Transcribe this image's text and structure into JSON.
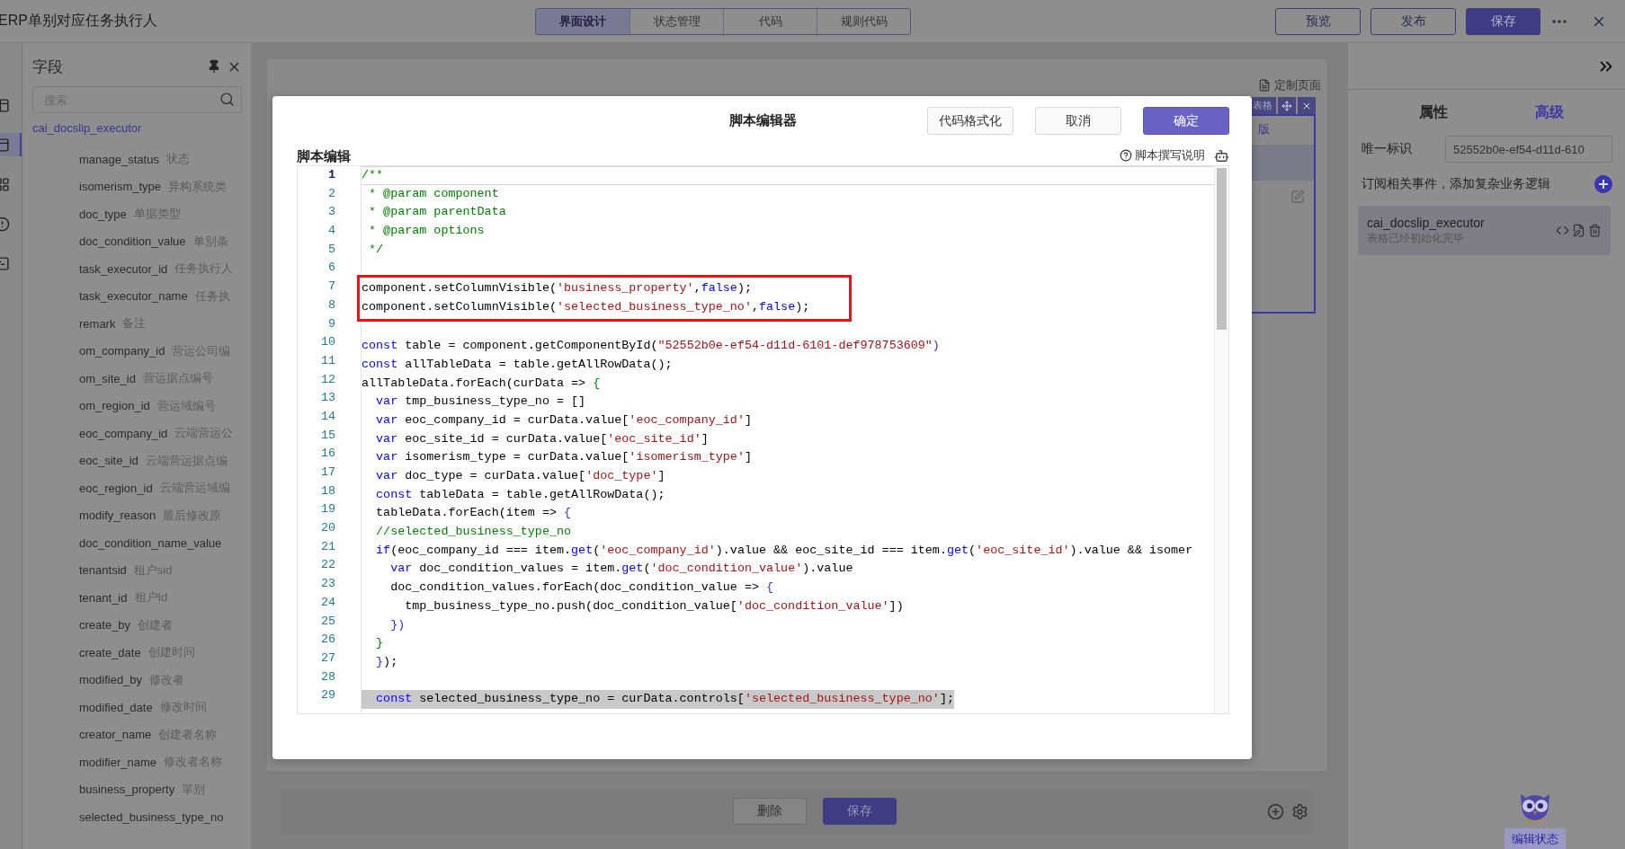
{
  "topbar": {
    "title": "ERP单别对应任务执行人",
    "tabs": [
      {
        "label": "界面设计",
        "selected": true
      },
      {
        "label": "状态管理",
        "selected": false
      },
      {
        "label": "代码",
        "selected": false
      },
      {
        "label": "规则代码",
        "selected": false
      }
    ],
    "buttons": [
      {
        "label": "预览",
        "kind": "outline"
      },
      {
        "label": "发布",
        "kind": "outline"
      },
      {
        "label": "保存",
        "kind": "primary"
      }
    ]
  },
  "sidebar_icons": [
    {
      "kind": "table",
      "selected": false
    },
    {
      "kind": "form",
      "selected": true
    },
    {
      "kind": "grid",
      "selected": false
    },
    {
      "kind": "alert",
      "selected": false
    },
    {
      "kind": "terminal",
      "selected": false
    }
  ],
  "field_panel": {
    "title": "字段",
    "search": {
      "placeholder": "搜索"
    },
    "table_name": "cai_docslip_executor",
    "fields": [
      {
        "name": "manage_status",
        "label": "状态"
      },
      {
        "name": "isomerism_type",
        "label": "异构系统类"
      },
      {
        "name": "doc_type",
        "label": "单据类型"
      },
      {
        "name": "doc_condition_value",
        "label": "单别条"
      },
      {
        "name": "task_executor_id",
        "label": "任务执行人"
      },
      {
        "name": "task_executor_name",
        "label": "任务执"
      },
      {
        "name": "remark",
        "label": "备注"
      },
      {
        "name": "om_company_id",
        "label": "营运公司编"
      },
      {
        "name": "om_site_id",
        "label": "营运据点编号"
      },
      {
        "name": "om_region_id",
        "label": "营运域编号"
      },
      {
        "name": "eoc_company_id",
        "label": "云端营运公"
      },
      {
        "name": "eoc_site_id",
        "label": "云端营运据点编"
      },
      {
        "name": "eoc_region_id",
        "label": "云端营运域编"
      },
      {
        "name": "modify_reason",
        "label": "最后修改原"
      },
      {
        "name": "doc_condition_name_value"
      },
      {
        "name": "tenantsid",
        "label": "租户sid"
      },
      {
        "name": "tenant_id",
        "label": "租户Id"
      },
      {
        "name": "create_by",
        "label": "创建者"
      },
      {
        "name": "create_date",
        "label": "创建时间"
      },
      {
        "name": "modified_by",
        "label": "修改者"
      },
      {
        "name": "modified_date",
        "label": "修改时间"
      },
      {
        "name": "creator_name",
        "label": "创建者名称"
      },
      {
        "name": "modifier_name",
        "label": "修改者名称"
      },
      {
        "name": "business_property",
        "label": "單别"
      },
      {
        "name": "selected_business_type_no"
      }
    ]
  },
  "canvas": {
    "page_label": "定制页面",
    "widget": {
      "tag": "表格",
      "link": "版"
    },
    "footer_buttons": [
      {
        "label": "删除",
        "kind": "default"
      },
      {
        "label": "保存",
        "kind": "primary"
      }
    ]
  },
  "properties": {
    "tabs": [
      {
        "label": "属性",
        "selected": false
      },
      {
        "label": "高级",
        "selected": true
      }
    ],
    "id_label": "唯一标识",
    "id_value": "52552b0e-ef54-d11d-610",
    "events_label": "订阅相关事件，添加复杂业务逻辑",
    "events": [
      {
        "name": "cai_docslip_executor",
        "description": "表格已经初始化完毕"
      }
    ]
  },
  "assistant": {
    "label": "编辑状态"
  },
  "dialog": {
    "title": "脚本编辑器",
    "buttons": [
      {
        "label": "代码格式化",
        "kind": "default"
      },
      {
        "label": "取消",
        "kind": "default"
      },
      {
        "label": "确定",
        "kind": "primary"
      }
    ],
    "section_label": "脚本编辑",
    "help_link": "脚本撰写说明",
    "lines": [
      {
        "n": "1",
        "current": true,
        "boxed": false,
        "selected": false,
        "tokens": [
          {
            "kind": "comment",
            "text": "/**"
          }
        ]
      },
      {
        "n": "2",
        "current": false,
        "boxed": false,
        "selected": false,
        "tokens": [
          {
            "kind": "comment",
            "text": " * @param component"
          }
        ]
      },
      {
        "n": "3",
        "current": false,
        "boxed": false,
        "selected": false,
        "tokens": [
          {
            "kind": "comment",
            "text": " * @param parentData"
          }
        ]
      },
      {
        "n": "4",
        "current": false,
        "boxed": false,
        "selected": false,
        "tokens": [
          {
            "kind": "comment",
            "text": " * @param options"
          }
        ]
      },
      {
        "n": "5",
        "current": false,
        "boxed": false,
        "selected": false,
        "tokens": [
          {
            "kind": "comment",
            "text": " */"
          }
        ]
      },
      {
        "n": "6",
        "current": false,
        "boxed": false,
        "selected": false
      },
      {
        "n": "7",
        "current": false,
        "boxed": true,
        "selected": false,
        "tokens": [
          {
            "kind": "plain",
            "text": "component.setColumnVisible("
          },
          {
            "kind": "string",
            "text": "'business_property'"
          },
          {
            "kind": "plain",
            "text": ","
          },
          {
            "kind": "keyword",
            "text": "false"
          },
          {
            "kind": "plain",
            "text": ");"
          }
        ]
      },
      {
        "n": "8",
        "current": false,
        "boxed": true,
        "selected": false,
        "tokens": [
          {
            "kind": "plain",
            "text": "component.setColumnVisible("
          },
          {
            "kind": "string",
            "text": "'selected_business_type_no'"
          },
          {
            "kind": "plain",
            "text": ","
          },
          {
            "kind": "keyword",
            "text": "false"
          },
          {
            "kind": "plain",
            "text": ");"
          }
        ]
      },
      {
        "n": "9",
        "current": false,
        "boxed": false,
        "selected": false
      },
      {
        "n": "10",
        "current": false,
        "boxed": false,
        "selected": false,
        "tokens": [
          {
            "kind": "keyword",
            "text": "const"
          },
          {
            "kind": "plain",
            "text": " table = component.getComponentById("
          },
          {
            "kind": "string",
            "text": "\"52552b0e-ef54-d11d-6101-def978753609\""
          },
          {
            "kind": "bracket",
            "text": ")"
          }
        ]
      },
      {
        "n": "11",
        "current": false,
        "boxed": false,
        "selected": false,
        "tokens": [
          {
            "kind": "keyword",
            "text": "const"
          },
          {
            "kind": "plain",
            "text": " allTableData = table.getAllRowData();"
          }
        ]
      },
      {
        "n": "12",
        "current": false,
        "boxed": false,
        "selected": false,
        "tokens": [
          {
            "kind": "plain",
            "text": "allTableData.forEach(curData => "
          },
          {
            "kind": "comment",
            "text": "{"
          }
        ]
      },
      {
        "n": "13",
        "current": false,
        "boxed": false,
        "selected": false,
        "tokens": [
          {
            "kind": "keyword",
            "text": "  var"
          },
          {
            "kind": "plain",
            "text": " tmp_business_type_no = []"
          }
        ]
      },
      {
        "n": "14",
        "current": false,
        "boxed": false,
        "selected": false,
        "tokens": [
          {
            "kind": "keyword",
            "text": "  var"
          },
          {
            "kind": "plain",
            "text": " eoc_company_id = curData.value["
          },
          {
            "kind": "string",
            "text": "'eoc_company_id'"
          },
          {
            "kind": "plain",
            "text": "]"
          }
        ]
      },
      {
        "n": "15",
        "current": false,
        "boxed": false,
        "selected": false,
        "tokens": [
          {
            "kind": "keyword",
            "text": "  var"
          },
          {
            "kind": "plain",
            "text": " eoc_site_id = curData.value["
          },
          {
            "kind": "string",
            "text": "'eoc_site_id'"
          },
          {
            "kind": "plain",
            "text": "]"
          }
        ]
      },
      {
        "n": "16",
        "current": false,
        "boxed": false,
        "selected": false,
        "tokens": [
          {
            "kind": "keyword",
            "text": "  var"
          },
          {
            "kind": "plain",
            "text": " isomerism_type = curData.value["
          },
          {
            "kind": "string",
            "text": "'isomerism_type'"
          },
          {
            "kind": "plain",
            "text": "]"
          }
        ]
      },
      {
        "n": "17",
        "current": false,
        "boxed": false,
        "selected": false,
        "tokens": [
          {
            "kind": "keyword",
            "text": "  var"
          },
          {
            "kind": "plain",
            "text": " doc_type = curData.value["
          },
          {
            "kind": "string",
            "text": "'doc_type'"
          },
          {
            "kind": "plain",
            "text": "]"
          }
        ]
      },
      {
        "n": "18",
        "current": false,
        "boxed": false,
        "selected": false,
        "tokens": [
          {
            "kind": "keyword",
            "text": "  const"
          },
          {
            "kind": "plain",
            "text": " tableData = table.getAllRowData();"
          }
        ]
      },
      {
        "n": "19",
        "current": false,
        "boxed": false,
        "selected": false,
        "tokens": [
          {
            "kind": "plain",
            "text": "  tableData.forEach(item => "
          },
          {
            "kind": "bracket",
            "text": "{"
          }
        ]
      },
      {
        "n": "20",
        "current": false,
        "boxed": false,
        "selected": false,
        "tokens": [
          {
            "kind": "comment",
            "text": "  //selected_business_type_no"
          }
        ]
      },
      {
        "n": "21",
        "current": false,
        "boxed": false,
        "selected": false,
        "tokens": [
          {
            "kind": "keyword",
            "text": "  if"
          },
          {
            "kind": "plain",
            "text": "(eoc_company_id === item."
          },
          {
            "kind": "keyword",
            "text": "get"
          },
          {
            "kind": "plain",
            "text": "("
          },
          {
            "kind": "string",
            "text": "'eoc_company_id'"
          },
          {
            "kind": "plain",
            "text": ").value && eoc_site_id === item."
          },
          {
            "kind": "keyword",
            "text": "get"
          },
          {
            "kind": "plain",
            "text": "("
          },
          {
            "kind": "string",
            "text": "'eoc_site_id'"
          },
          {
            "kind": "plain",
            "text": ").value && isomer"
          }
        ]
      },
      {
        "n": "22",
        "current": false,
        "boxed": false,
        "selected": false,
        "tokens": [
          {
            "kind": "keyword",
            "text": "    var"
          },
          {
            "kind": "plain",
            "text": " doc_condition_values = item."
          },
          {
            "kind": "keyword",
            "text": "get"
          },
          {
            "kind": "plain",
            "text": "("
          },
          {
            "kind": "string",
            "text": "'doc_condition_value'"
          },
          {
            "kind": "plain",
            "text": ").value"
          }
        ]
      },
      {
        "n": "23",
        "current": false,
        "boxed": false,
        "selected": false,
        "tokens": [
          {
            "kind": "plain",
            "text": "    doc_condition_values.forEach(doc_condition_value => "
          },
          {
            "kind": "bracket",
            "text": "{"
          }
        ]
      },
      {
        "n": "24",
        "current": false,
        "boxed": false,
        "selected": false,
        "tokens": [
          {
            "kind": "plain",
            "text": "      tmp_business_type_no.push(doc_condition_value["
          },
          {
            "kind": "string",
            "text": "'doc_condition_value'"
          },
          {
            "kind": "plain",
            "text": "])"
          }
        ]
      },
      {
        "n": "25",
        "current": false,
        "boxed": false,
        "selected": false,
        "tokens": [
          {
            "kind": "bracket",
            "text": "    })"
          }
        ]
      },
      {
        "n": "26",
        "current": false,
        "boxed": false,
        "selected": false,
        "tokens": [
          {
            "kind": "comment",
            "text": "  }"
          }
        ]
      },
      {
        "n": "27",
        "current": false,
        "boxed": false,
        "selected": false,
        "tokens": [
          {
            "kind": "bracket",
            "text": "  }"
          },
          {
            "kind": "plain",
            "text": ");"
          }
        ]
      },
      {
        "n": "28",
        "current": false,
        "boxed": false,
        "selected": false
      },
      {
        "n": "29",
        "current": false,
        "boxed": false,
        "selected": true,
        "tokens": [
          {
            "kind": "keyword",
            "text": "  const"
          },
          {
            "kind": "plain",
            "text": " selected_business_type_no = curData.controls["
          },
          {
            "kind": "string",
            "text": "'selected_business_type_no'"
          },
          {
            "kind": "plain",
            "text": "];"
          }
        ]
      }
    ]
  }
}
